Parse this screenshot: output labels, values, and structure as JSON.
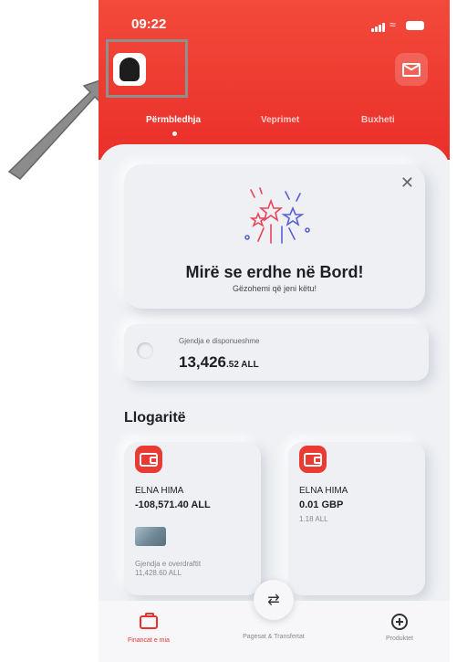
{
  "status_bar": {
    "time": "09:22"
  },
  "header": {
    "avatar_icon": "user-avatar-icon",
    "mail_icon": "mail-icon"
  },
  "tabs": [
    {
      "label": "Përmbledhja",
      "active": true
    },
    {
      "label": "Veprimet",
      "active": false
    },
    {
      "label": "Buxheti",
      "active": false
    }
  ],
  "welcome": {
    "title": "Mirë se erdhe në Bord!",
    "subtitle": "Gëzohemi që jeni këtu!",
    "close_icon": "close-icon"
  },
  "balance": {
    "label": "Gjendja e disponueshme",
    "amount_main": "13,426",
    "amount_cents": ".52 ALL"
  },
  "accounts": {
    "title": "Llogaritë",
    "items": [
      {
        "name": "ELNA HIMA",
        "value": "-108,571.40 ALL",
        "overdraft_label": "Gjendja e overdraftit",
        "overdraft_value": "11,428.60 ALL"
      },
      {
        "name": "ELNA HIMA",
        "value": "0.01 GBP",
        "sub": "1.18 ALL"
      }
    ]
  },
  "bottom_nav": [
    {
      "label": "Financat e mia",
      "icon": "briefcase-icon",
      "active": true
    },
    {
      "label": "Pagesat & Transfertat",
      "icon": "transfer-icon",
      "active": false
    },
    {
      "label": "Produktet",
      "icon": "plus-circle-icon",
      "active": false
    }
  ],
  "colors": {
    "accent": "#ea2f2a",
    "background": "#eef0f3"
  }
}
